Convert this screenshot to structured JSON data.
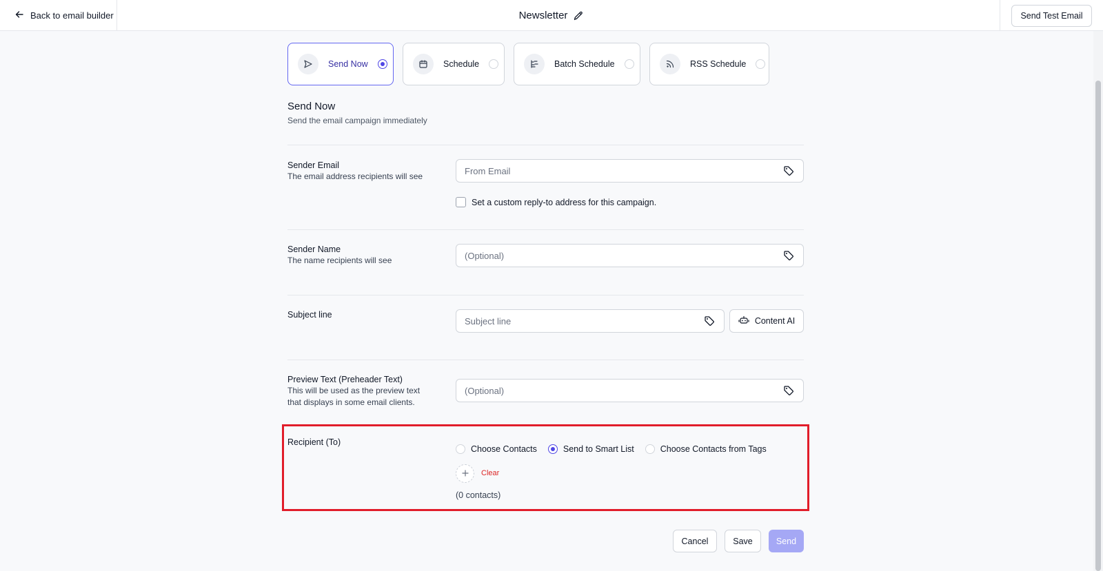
{
  "header": {
    "back_label": "Back to email builder",
    "title": "Newsletter",
    "send_test_label": "Send Test Email"
  },
  "modes": [
    {
      "label": "Send Now",
      "icon": "send-icon",
      "selected": true
    },
    {
      "label": "Schedule",
      "icon": "calendar-icon",
      "selected": false
    },
    {
      "label": "Batch Schedule",
      "icon": "batch-icon",
      "selected": false
    },
    {
      "label": "RSS Schedule",
      "icon": "rss-icon",
      "selected": false
    }
  ],
  "section": {
    "title": "Send Now",
    "subtitle": "Send the email campaign immediately"
  },
  "sender_email": {
    "label": "Sender Email",
    "description": "The email address recipients will see",
    "placeholder": "From Email",
    "reply_to_label": "Set a custom reply-to address for this campaign.",
    "reply_to_checked": false
  },
  "sender_name": {
    "label": "Sender Name",
    "description": "The name recipients will see",
    "placeholder": "(Optional)"
  },
  "subject": {
    "label": "Subject line",
    "placeholder": "Subject line",
    "content_ai_label": "Content AI"
  },
  "preview_text": {
    "label": "Preview Text (Preheader Text)",
    "description": "This will be used as the preview text that displays in some email clients.",
    "placeholder": "(Optional)"
  },
  "recipient": {
    "label": "Recipient (To)",
    "options": [
      {
        "label": "Choose Contacts",
        "selected": false
      },
      {
        "label": "Send to Smart List",
        "selected": true
      },
      {
        "label": "Choose Contacts from Tags",
        "selected": false
      }
    ],
    "clear_label": "Clear",
    "count_text": "(0 contacts)"
  },
  "footer": {
    "cancel_label": "Cancel",
    "save_label": "Save",
    "send_label": "Send"
  },
  "colors": {
    "accent": "#4f46e5",
    "highlight": "#e11d2a",
    "send_button": "#a5a8f5"
  }
}
